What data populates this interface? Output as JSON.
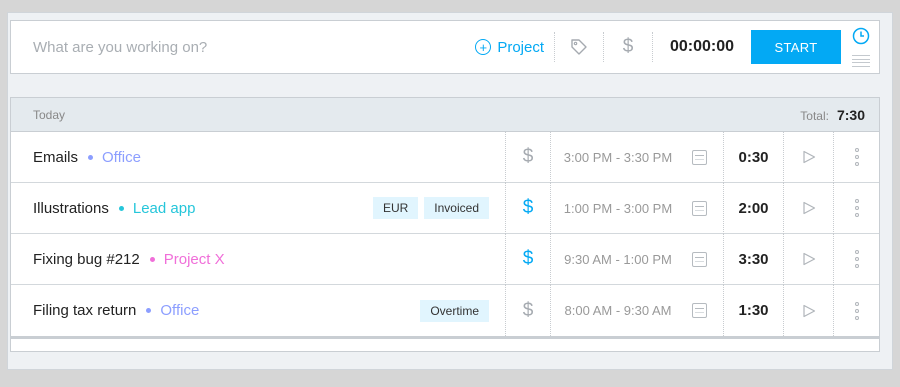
{
  "timer": {
    "description_placeholder": "What are you working on?",
    "project_label": "Project",
    "tag_icon": "tag-icon",
    "billable_symbol": "$",
    "elapsed": "00:00:00",
    "start_label": "START",
    "mode_icon": "clock-icon"
  },
  "day": {
    "label": "Today",
    "total_label": "Total:",
    "total_value": "7:30"
  },
  "colors": {
    "accent": "#03a9f4",
    "billable_active": "#03a9f4",
    "billable_inactive": "#a5aab0",
    "tag_bg": "#e1f5fe"
  },
  "entries": [
    {
      "description": "Emails",
      "project": "Office",
      "project_color": "#8c9eff",
      "tags": [],
      "billable": false,
      "range": "3:00 PM - 3:30 PM",
      "duration": "0:30"
    },
    {
      "description": "Illustrations",
      "project": "Lead app",
      "project_color": "#26c6da",
      "tags": [
        "EUR",
        "Invoiced"
      ],
      "billable": true,
      "range": "1:00 PM - 3:00 PM",
      "duration": "2:00"
    },
    {
      "description": "Fixing bug #212",
      "project": "Project X",
      "project_color": "#f06fd9",
      "tags": [],
      "billable": true,
      "range": "9:30 AM - 1:00 PM",
      "duration": "3:30"
    },
    {
      "description": "Filing tax return",
      "project": "Office",
      "project_color": "#8c9eff",
      "tags": [
        "Overtime"
      ],
      "billable": false,
      "range": "8:00 AM - 9:30 AM",
      "duration": "1:30"
    }
  ]
}
